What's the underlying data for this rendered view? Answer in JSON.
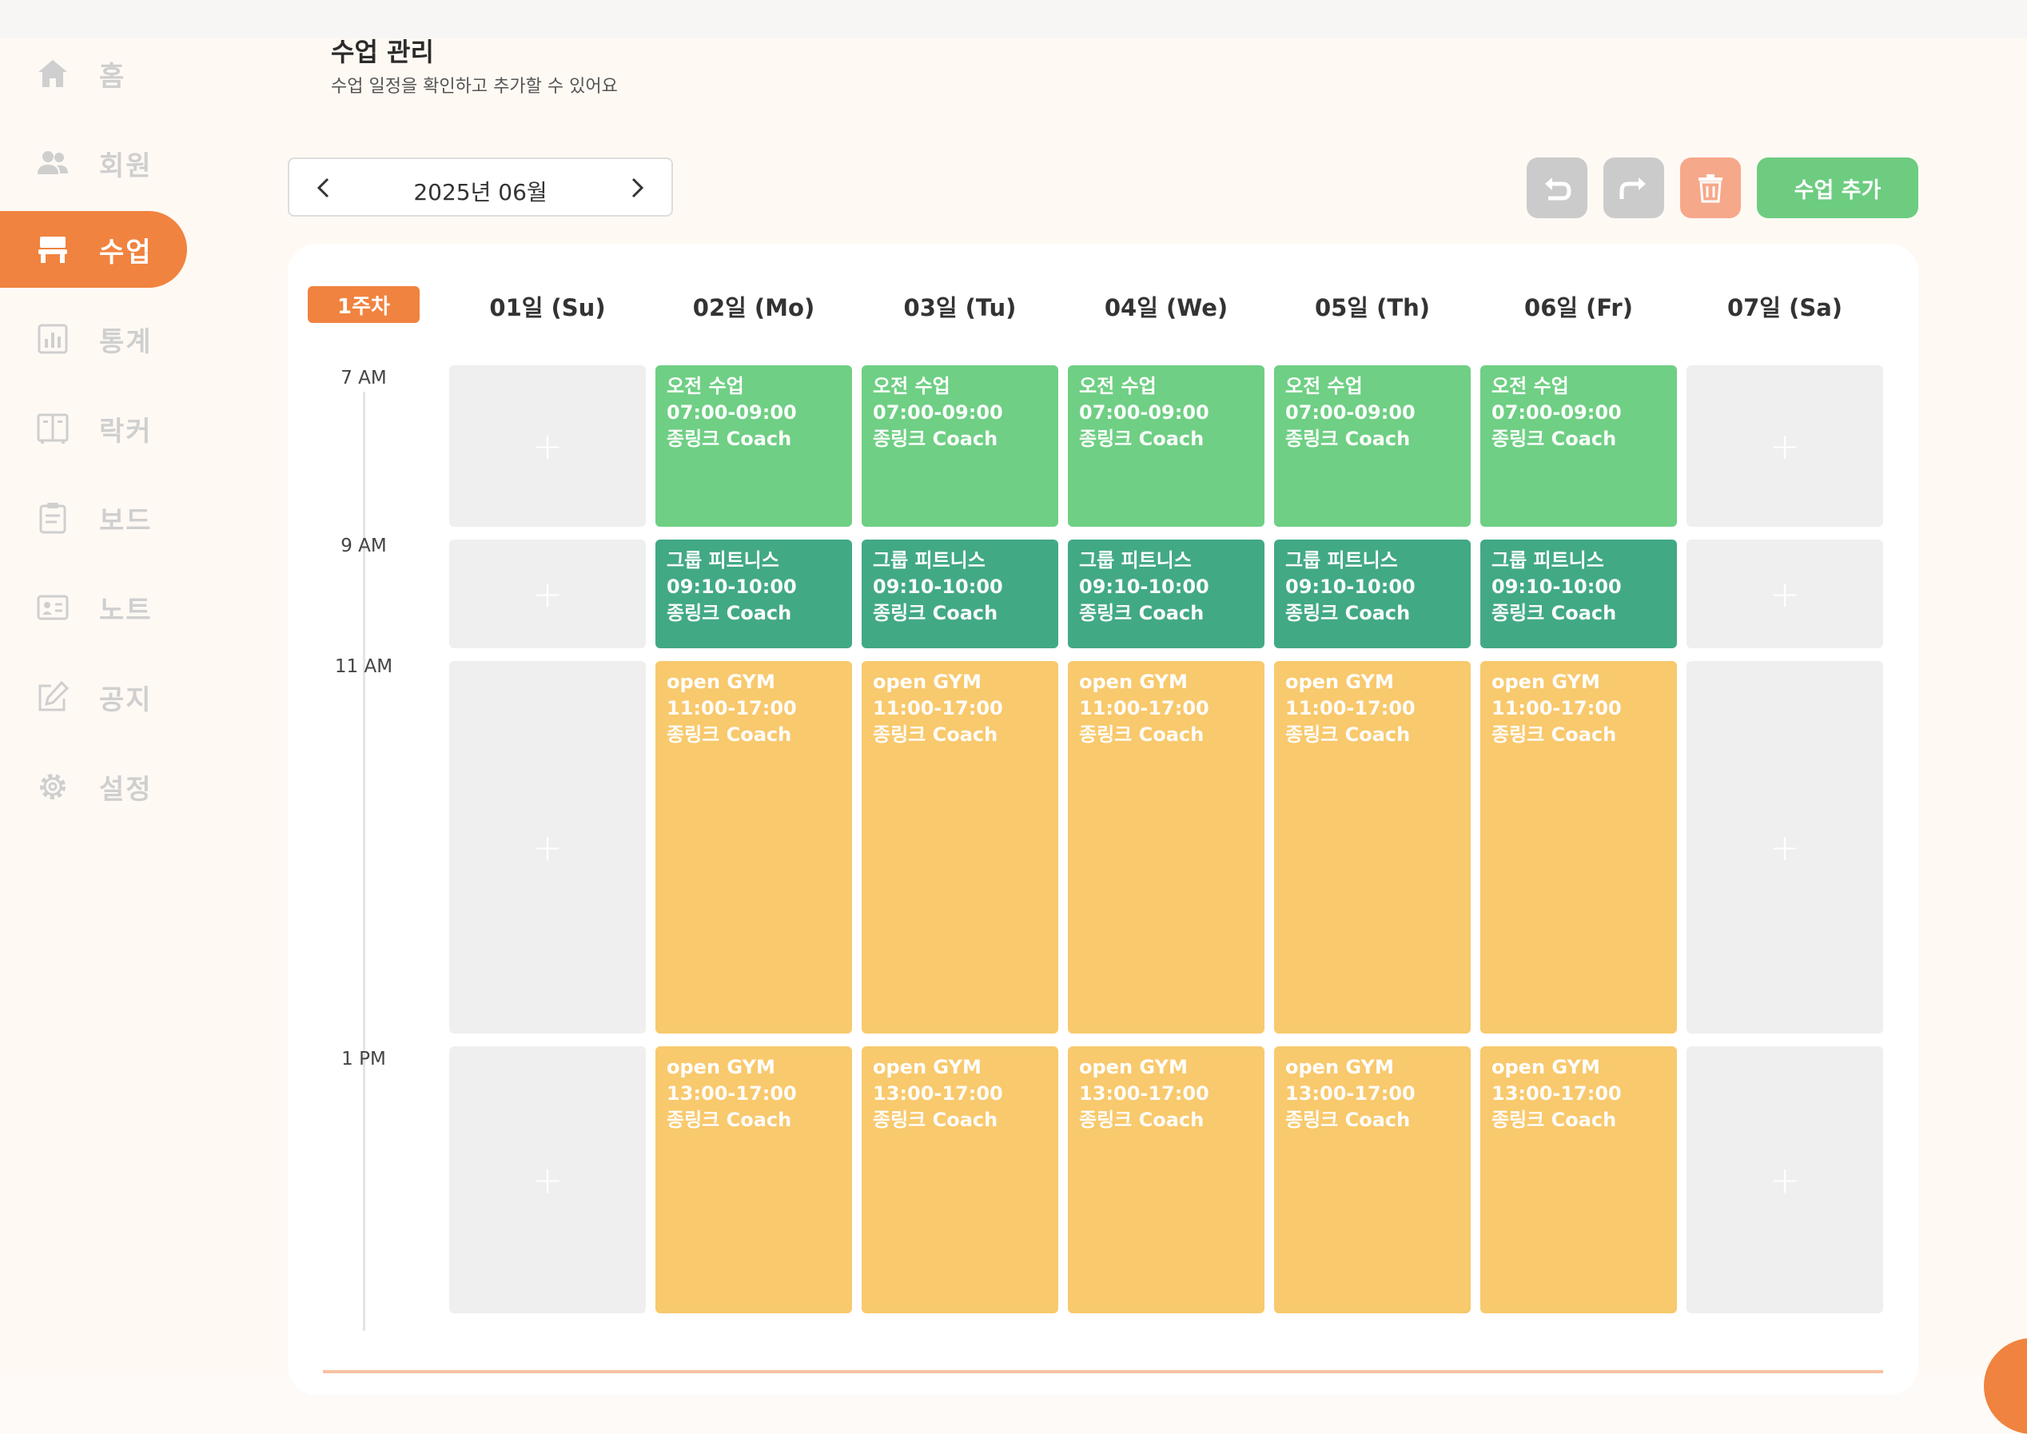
{
  "colors": {
    "accent": "#f0833f",
    "green": "#6fcf84",
    "teal": "#42a985",
    "yellow": "#f8c96d",
    "empty": "#efefef"
  },
  "sidebar": {
    "items": [
      {
        "label": "홈",
        "icon": "home-icon",
        "active": false
      },
      {
        "label": "회원",
        "icon": "members-icon",
        "active": false
      },
      {
        "label": "수업",
        "icon": "class-icon",
        "active": true
      },
      {
        "label": "통계",
        "icon": "stats-icon",
        "active": false
      },
      {
        "label": "락커",
        "icon": "locker-icon",
        "active": false
      },
      {
        "label": "보드",
        "icon": "board-icon",
        "active": false
      },
      {
        "label": "노트",
        "icon": "note-icon",
        "active": false
      },
      {
        "label": "공지",
        "icon": "notice-icon",
        "active": false
      },
      {
        "label": "설정",
        "icon": "settings-icon",
        "active": false
      }
    ]
  },
  "header": {
    "title": "수업 관리",
    "subtitle": "수업 일정을 확인하고 추가할 수 있어요"
  },
  "month_selector": {
    "label": "2025년 06월"
  },
  "toolbar": {
    "add_label": "수업 추가"
  },
  "calendar": {
    "week_label": "1주차",
    "days": [
      "01일 (Su)",
      "02일 (Mo)",
      "03일 (Tu)",
      "04일 (We)",
      "05일 (Th)",
      "06일 (Fr)",
      "07일 (Sa)"
    ],
    "time_labels": [
      "7 AM",
      "9 AM",
      "11 AM",
      "1 PM"
    ],
    "empty_symbol": "+",
    "rows": [
      {
        "name": "오전 수업",
        "time": "07:00-09:00",
        "coach": "종링크 Coach",
        "color": "green"
      },
      {
        "name": "그룹 피트니스",
        "time": "09:10-10:00",
        "coach": "종링크 Coach",
        "color": "teal"
      },
      {
        "name": "open GYM",
        "time": "11:00-17:00",
        "coach": "종링크 Coach",
        "color": "yellow"
      },
      {
        "name": "open GYM",
        "time": "13:00-17:00",
        "coach": "종링크 Coach",
        "color": "yellow"
      }
    ],
    "event_days": [
      1,
      2,
      3,
      4,
      5
    ]
  }
}
